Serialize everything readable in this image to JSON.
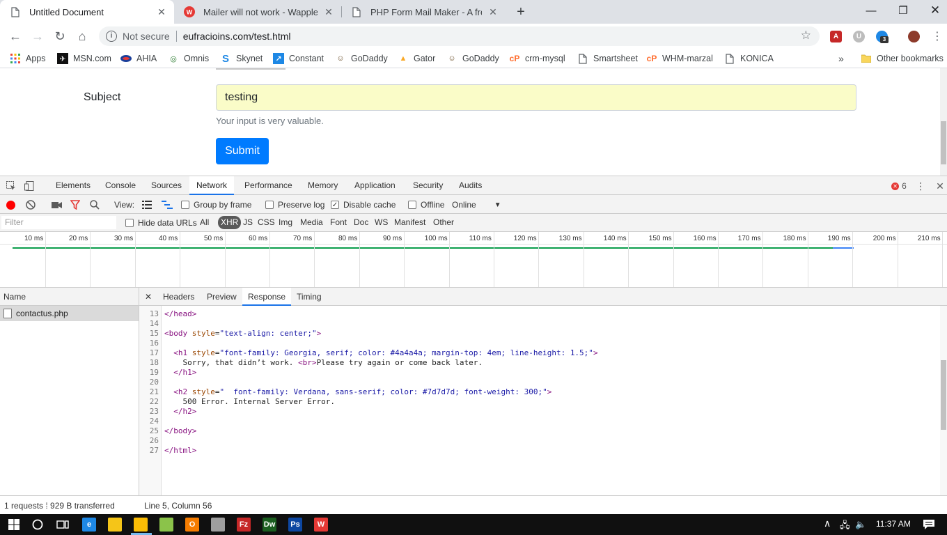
{
  "tabs": [
    {
      "title": "Untitled Document",
      "active": true
    },
    {
      "title": "Mailer will not work - Wappler Ge",
      "active": false
    },
    {
      "title": "PHP Form Mail Maker - A free to",
      "active": false
    }
  ],
  "toolbar": {
    "security_label": "Not secure",
    "url": "eufracioins.com/test.html",
    "ext_badge": "3"
  },
  "bookmarks": [
    {
      "label": "Apps",
      "icon": "apps-grid-icon",
      "color": "#ea4335"
    },
    {
      "label": "MSN.com",
      "icon": "msn-icon",
      "color": "#111111"
    },
    {
      "label": "AHIA",
      "icon": "ahia-icon",
      "color": "#1b3f9a"
    },
    {
      "label": "Omnis",
      "icon": "omnis-icon",
      "color": "#2e7d32"
    },
    {
      "label": "Skynet",
      "icon": "skynet-icon",
      "color": "#1e88e5"
    },
    {
      "label": "Constant",
      "icon": "constant-icon",
      "color": "#1e88e5"
    },
    {
      "label": "GoDaddy",
      "icon": "godaddy-icon",
      "color": "#6b4f2a"
    },
    {
      "label": "Gator",
      "icon": "gator-icon",
      "color": "#f9a825"
    },
    {
      "label": "GoDaddy",
      "icon": "godaddy-icon",
      "color": "#6b4f2a"
    },
    {
      "label": "crm-mysql",
      "icon": "cpanel-icon",
      "color": "#ff6c2c"
    },
    {
      "label": "Smartsheet",
      "icon": "page-icon",
      "color": "#5f6368"
    },
    {
      "label": "WHM-marzal",
      "icon": "cpanel-icon",
      "color": "#ff6c2c"
    },
    {
      "label": "KONICA",
      "icon": "page-icon",
      "color": "#5f6368"
    }
  ],
  "bookmarks_more": "»",
  "other_bookmarks": "Other bookmarks",
  "form": {
    "subject_label": "Subject",
    "subject_value": "testing",
    "help_text": "Your input is very valuable.",
    "submit_label": "Submit"
  },
  "devtools": {
    "tabs": [
      "Elements",
      "Console",
      "Sources",
      "Network",
      "Performance",
      "Memory",
      "Application",
      "Security",
      "Audits"
    ],
    "active_tab": "Network",
    "error_count": "6",
    "controls": {
      "view_label": "View:",
      "group_by_frame": "Group by frame",
      "preserve_log": "Preserve log",
      "disable_cache": "Disable cache",
      "offline": "Offline",
      "throttle": "Online"
    },
    "filter": {
      "placeholder": "Filter",
      "hide_data_urls": "Hide data URLs",
      "types": [
        "All",
        "XHR",
        "JS",
        "CSS",
        "Img",
        "Media",
        "Font",
        "Doc",
        "WS",
        "Manifest",
        "Other"
      ],
      "active_type": "XHR"
    },
    "timeline_ticks": [
      "10 ms",
      "20 ms",
      "30 ms",
      "40 ms",
      "50 ms",
      "60 ms",
      "70 ms",
      "80 ms",
      "90 ms",
      "100 ms",
      "110 ms",
      "120 ms",
      "130 ms",
      "140 ms",
      "150 ms",
      "160 ms",
      "170 ms",
      "180 ms",
      "190 ms",
      "200 ms",
      "210 ms"
    ],
    "name_header": "Name",
    "requests": [
      "contactus.php"
    ],
    "detail_tabs": [
      "Headers",
      "Preview",
      "Response",
      "Timing"
    ],
    "active_detail_tab": "Response",
    "code_lines": [
      {
        "n": "13",
        "html": "<span class=\"tag\">&lt;/head&gt;</span>"
      },
      {
        "n": "14",
        "html": ""
      },
      {
        "n": "15",
        "html": "<span class=\"tag\">&lt;body</span> <span class=\"attr\">style</span>=<span class=\"val\">\"text-align: center;\"</span><span class=\"tag\">&gt;</span>"
      },
      {
        "n": "16",
        "html": ""
      },
      {
        "n": "17",
        "html": "  <span class=\"tag\">&lt;h1</span> <span class=\"attr\">style</span>=<span class=\"val\">\"font-family: Georgia, serif; color: #4a4a4a; margin-top: 4em; line-height: 1.5;\"</span><span class=\"tag\">&gt;</span>"
      },
      {
        "n": "18",
        "html": "    Sorry, that didn’t work. <span class=\"tag\">&lt;br&gt;</span>Please try again or come back later."
      },
      {
        "n": "19",
        "html": "  <span class=\"tag\">&lt;/h1&gt;</span>"
      },
      {
        "n": "20",
        "html": ""
      },
      {
        "n": "21",
        "html": "  <span class=\"tag\">&lt;h2</span> <span class=\"attr\">style</span>=<span class=\"val\">\"  font-family: Verdana, sans-serif; color: #7d7d7d; font-weight: 300;\"</span><span class=\"tag\">&gt;</span>"
      },
      {
        "n": "22",
        "html": "    500 Error. Internal Server Error."
      },
      {
        "n": "23",
        "html": "  <span class=\"tag\">&lt;/h2&gt;</span>"
      },
      {
        "n": "24",
        "html": ""
      },
      {
        "n": "25",
        "html": "<span class=\"tag\">&lt;/body&gt;</span>"
      },
      {
        "n": "26",
        "html": ""
      },
      {
        "n": "27",
        "html": "<span class=\"tag\">&lt;/html&gt;</span>"
      }
    ],
    "status_left": "1 requests  ⁞  929 B transferred",
    "status_right": "Line 5, Column 56"
  },
  "taskbar": {
    "clock": "11:37 AM",
    "apps": [
      {
        "name": "taskbar-edge-icon",
        "glyph": "e",
        "color": "#1e88e5"
      },
      {
        "name": "taskbar-explorer-icon",
        "glyph": "",
        "color": "#f5c518"
      },
      {
        "name": "taskbar-chrome-icon",
        "glyph": "",
        "color": "#fbbc05"
      },
      {
        "name": "taskbar-notepad-icon",
        "glyph": "",
        "color": "#8bc34a"
      },
      {
        "name": "taskbar-outlook-icon",
        "glyph": "O",
        "color": "#f57c00"
      },
      {
        "name": "taskbar-calculator-icon",
        "glyph": "",
        "color": "#9e9e9e"
      },
      {
        "name": "taskbar-filezilla-icon",
        "glyph": "Fz",
        "color": "#c62828"
      },
      {
        "name": "taskbar-dreamweaver-icon",
        "glyph": "Dw",
        "color": "#1b5e20"
      },
      {
        "name": "taskbar-photoshop-icon",
        "glyph": "Ps",
        "color": "#0d47a1"
      },
      {
        "name": "taskbar-wappler-icon",
        "glyph": "W",
        "color": "#e53935"
      }
    ]
  },
  "colors": {
    "accent_blue": "#007bff",
    "input_autofill": "#fafcc8",
    "devtools_active": "#1a73e8",
    "record_red": "#ff0000"
  }
}
